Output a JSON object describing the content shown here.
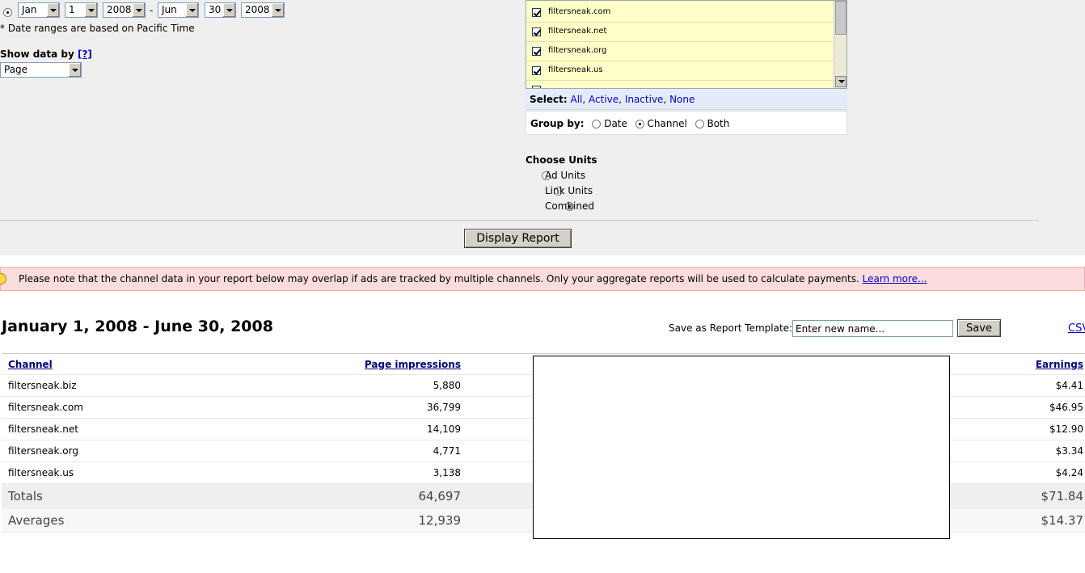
{
  "date_range": {
    "start_month": "Jan",
    "start_day": "1",
    "start_year": "2008",
    "separator": "-",
    "end_month": "Jun",
    "end_day": "30",
    "end_year": "2008",
    "note": "* Date ranges are based on Pacific Time"
  },
  "show_data_by": {
    "label": "Show data by ",
    "help": "[?]",
    "value": "Page"
  },
  "channels": {
    "items": [
      {
        "label": "filtersneak.com",
        "checked": true
      },
      {
        "label": "filtersneak.net",
        "checked": true
      },
      {
        "label": "filtersneak.org",
        "checked": true
      },
      {
        "label": "filtersneak.us",
        "checked": true
      }
    ],
    "select_label": "Select:",
    "select_all": "All",
    "select_active": "Active",
    "select_inactive": "Inactive",
    "select_none": "None",
    "group_by_label": "Group by:",
    "group_by_options": [
      "Date",
      "Channel",
      "Both"
    ],
    "group_by_selected": "Channel"
  },
  "choose_units": {
    "title": "Choose Units",
    "options": [
      "Ad Units",
      "Link Units",
      "Combined"
    ],
    "selected": "Combined"
  },
  "display_report_label": "Display Report",
  "notice": {
    "text": "Please note that the channel data in your report below may overlap if ads are tracked by multiple channels. Only your aggregate reports will be used to calculate payments.",
    "link": "Learn more..."
  },
  "report": {
    "title": "January 1, 2008 - June 30, 2008",
    "save_template_label": "Save as Report Template:",
    "template_placeholder": "Enter new name...",
    "save_label": "Save",
    "csv_label": "CSV",
    "columns": {
      "channel": "Channel",
      "impressions": "Page impressions",
      "earnings": "Earnings"
    },
    "rows": [
      {
        "channel": "filtersneak.biz",
        "impressions": "5,880",
        "earnings": "$4.41"
      },
      {
        "channel": "filtersneak.com",
        "impressions": "36,799",
        "earnings": "$46.95"
      },
      {
        "channel": "filtersneak.net",
        "impressions": "14,109",
        "earnings": "$12.90"
      },
      {
        "channel": "filtersneak.org",
        "impressions": "4,771",
        "earnings": "$3.34"
      },
      {
        "channel": "filtersneak.us",
        "impressions": "3,138",
        "earnings": "$4.24"
      }
    ],
    "totals": {
      "label": "Totals",
      "impressions": "64,697",
      "earnings": "$71.84"
    },
    "averages": {
      "label": "Averages",
      "impressions": "12,939",
      "earnings": "$14.37"
    }
  }
}
